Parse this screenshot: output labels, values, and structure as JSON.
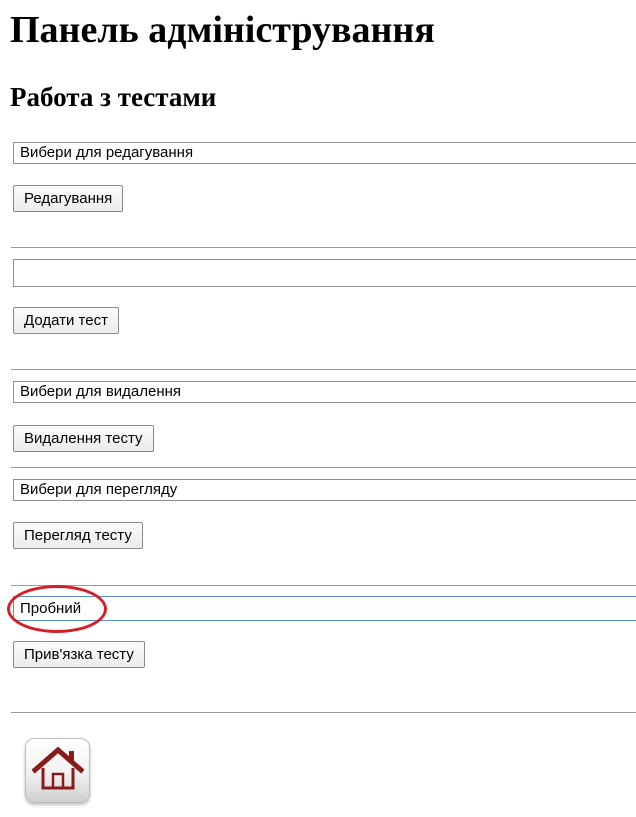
{
  "page": {
    "title": "Панель адміністрування",
    "section_title": "Работа з тестами"
  },
  "edit": {
    "select_value": "Вибери для редагування",
    "button_label": "Редагування"
  },
  "add": {
    "input_value": "",
    "button_label": "Додати тест"
  },
  "delete": {
    "select_value": "Вибери для видалення",
    "button_label": "Видалення тесту"
  },
  "view": {
    "select_value": "Вибери для перегляду",
    "button_label": "Перегляд тесту"
  },
  "bind_test": {
    "select_value": "Пробний",
    "button_label": "Прив'язка тесту"
  },
  "colors": {
    "annotation": "#d51f26",
    "focus_border": "#5b8fd6",
    "home_icon": "#8b1a1a"
  },
  "icons": {
    "home": "home-icon"
  }
}
